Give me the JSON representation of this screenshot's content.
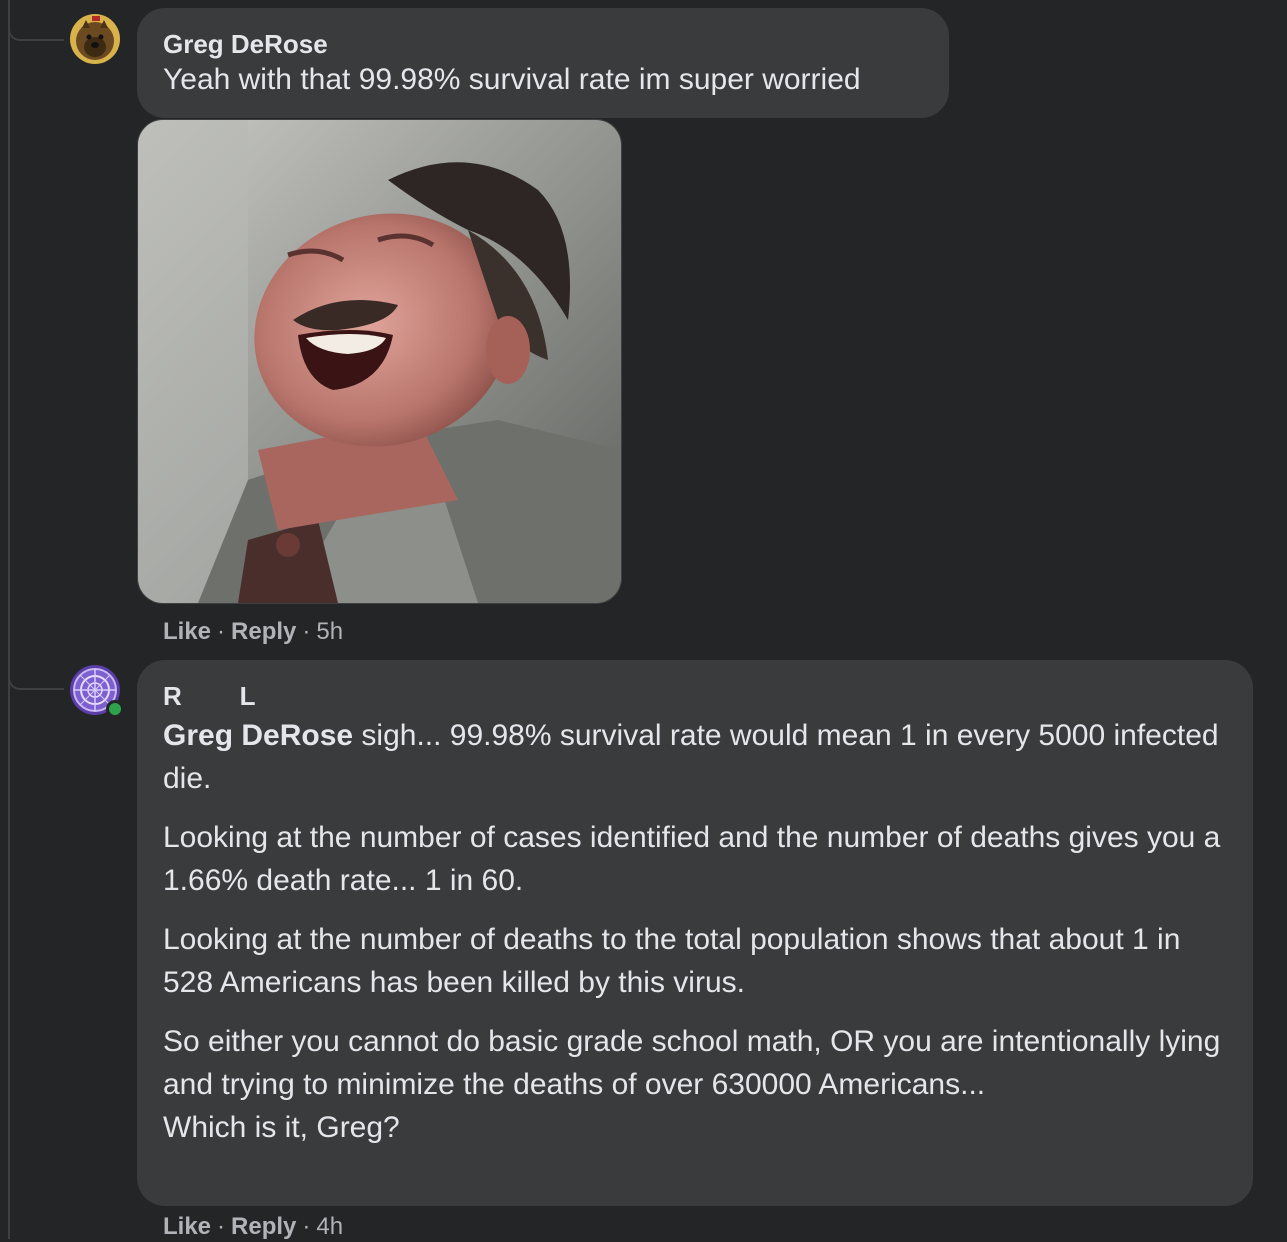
{
  "comments": [
    {
      "author": "Greg DeRose",
      "text": "Yeah with that 99.98% survival rate im super worried",
      "actions": {
        "like": "Like",
        "dot1": "·",
        "reply": "Reply",
        "dot2": "·",
        "time": "5h"
      }
    },
    {
      "author": "R        L",
      "mention": "Greg DeRose",
      "p1_rest": " sigh... 99.98% survival rate would mean 1 in every 5000 infected die.",
      "p2": "Looking at the number of cases identified and the number of deaths gives you a 1.66% death rate... 1 in 60.",
      "p3": "Looking at the number of deaths to the total population shows that about 1 in 528 Americans has been killed by this virus.",
      "p4": "So either you cannot do basic grade school math, OR you are intentionally lying and trying to minimize the deaths of over 630000 Americans...",
      "p5": "Which is it, Greg?",
      "actions": {
        "like": "Like",
        "dot1": "·",
        "reply": "Reply",
        "dot2": "·",
        "time": "4h"
      }
    }
  ],
  "colors": {
    "background": "#242526",
    "bubble": "#3a3b3c",
    "text": "#e4e6eb",
    "secondary": "#b0b3b8",
    "online": "#31a24c"
  },
  "icons": {
    "avatar1": "dog-avatar",
    "avatar2": "purple-emblem-avatar",
    "media": "laughing-man-gif"
  }
}
